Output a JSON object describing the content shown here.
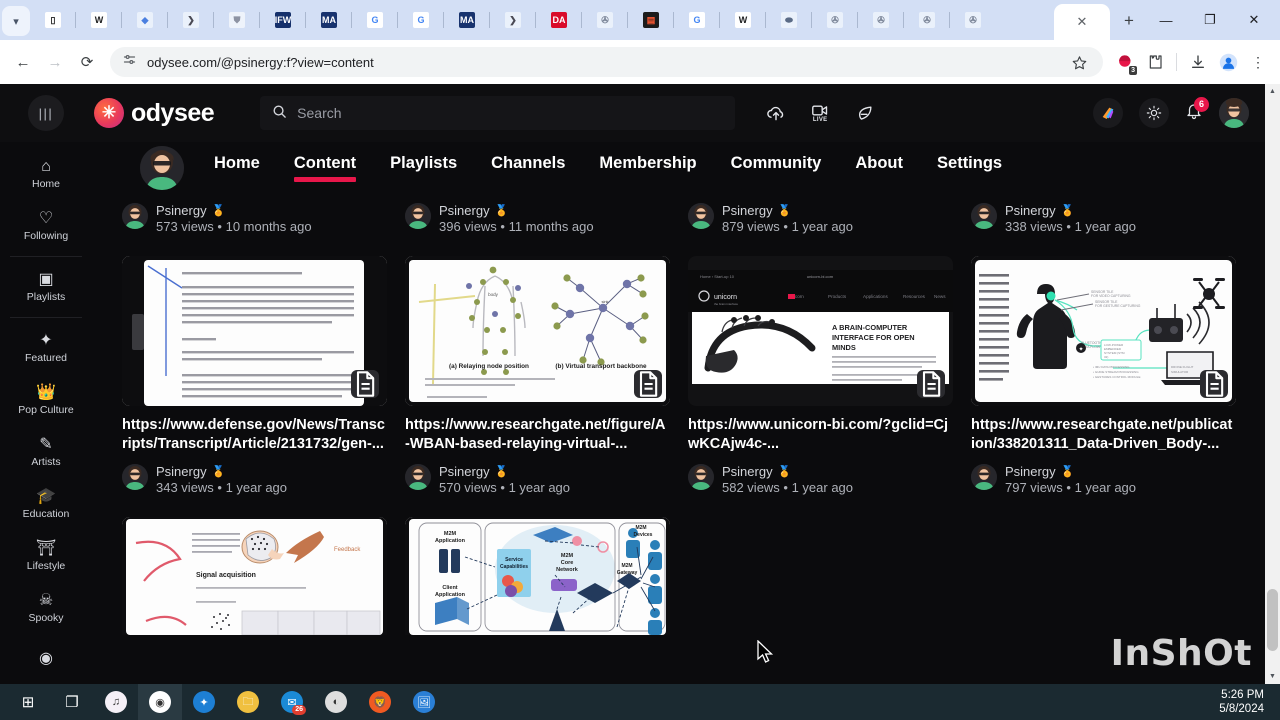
{
  "browser": {
    "tab_scroll_icon": "chevron-down-icon",
    "tabs": [
      {
        "icon": "reading-list-icon",
        "label": "▯",
        "bg": "#ffffff",
        "fg": "#1a1a1a"
      },
      {
        "icon": "wikipedia-icon",
        "label": "W",
        "bg": "#ffffff",
        "fg": "#202122"
      },
      {
        "icon": "diamond-icon",
        "label": "◆",
        "bg": "#eaf1fb",
        "fg": "#4a7fe0"
      },
      {
        "icon": "brave-icon",
        "label": "❯",
        "bg": "#eaf1fb",
        "fg": "#4a4a55"
      },
      {
        "icon": "shield-icon",
        "label": "⛊",
        "bg": "#eef3fb",
        "fg": "#8d93a3"
      },
      {
        "icon": "ifw-icon",
        "label": "IFW",
        "bg": "#15306b",
        "fg": "#ffffff"
      },
      {
        "icon": "ma-icon",
        "label": "MA",
        "bg": "#18336e",
        "fg": "#ffffff"
      },
      {
        "icon": "google-icon",
        "label": "G",
        "bg": "#ffffff",
        "fg": "#4285f4"
      },
      {
        "icon": "google-icon",
        "label": "G",
        "bg": "#ffffff",
        "fg": "#4285f4"
      },
      {
        "icon": "ma-icon",
        "label": "MA",
        "bg": "#18336e",
        "fg": "#ffffff"
      },
      {
        "icon": "brave-icon",
        "label": "❯",
        "bg": "#eaf1fb",
        "fg": "#4a4a55"
      },
      {
        "icon": "daic-icon",
        "label": "DA",
        "bg": "#d90b2a",
        "fg": "#ffffff"
      },
      {
        "icon": "globe-icon",
        "label": "✇",
        "bg": "#eaf1fb",
        "fg": "#7a8497"
      },
      {
        "icon": "news-icon",
        "label": "▤",
        "bg": "#1c1c1c",
        "fg": "#ff5a33"
      },
      {
        "icon": "google-icon",
        "label": "G",
        "bg": "#ffffff",
        "fg": "#4285f4"
      },
      {
        "icon": "wikipedia-icon",
        "label": "W",
        "bg": "#ffffff",
        "fg": "#202122"
      },
      {
        "icon": "link-icon",
        "label": "⬬",
        "bg": "#eaf1fb",
        "fg": "#5a6b86"
      },
      {
        "icon": "globe-icon",
        "label": "✇",
        "bg": "#eaf1fb",
        "fg": "#7a8497"
      },
      {
        "icon": "globe-icon",
        "label": "✇",
        "bg": "#eaf1fb",
        "fg": "#7a8497"
      },
      {
        "icon": "globe-icon",
        "label": "✇",
        "bg": "#eaf1fb",
        "fg": "#7a8497"
      },
      {
        "icon": "globe-icon",
        "label": "✇",
        "bg": "#eaf1fb",
        "fg": "#7a8497"
      }
    ],
    "active_tab_close": "✕",
    "new_tab_label": "+",
    "window_minimize": "—",
    "window_maximize": "❐",
    "window_close": "✕",
    "back_label": "←",
    "forward_label": "→",
    "reload_label": "⟳",
    "site_info_icon": "tune-icon",
    "url": "odysee.com/@psinergy:f?view=content",
    "bookmark_icon": "star-icon",
    "extension_badge_count": "3",
    "extensions_icon": "puzzle-icon",
    "downloads_icon": "download-icon",
    "profile_icon": "account-icon",
    "menu_icon": "kebab-menu-icon"
  },
  "odysee": {
    "brand_name": "odysee",
    "menu_icon": "hamburger-icon",
    "search": {
      "placeholder": "Search",
      "value": "",
      "icon": "magnifier-icon"
    },
    "header_actions": [
      {
        "name": "upload-icon",
        "glyph": "☁"
      },
      {
        "name": "go-live-icon",
        "glyph": "▣",
        "sub": "LIVE"
      },
      {
        "name": "post-icon",
        "glyph": "✎"
      }
    ],
    "header_right": [
      {
        "name": "rewards-icon",
        "glyph": "◥"
      },
      {
        "name": "theme-toggle-icon",
        "glyph": "☀"
      }
    ],
    "notification_count": "6",
    "notification_icon": "bell-icon",
    "avatar_name": "user-avatar"
  },
  "sidebar": {
    "items": [
      {
        "label": "Home",
        "icon": "home-icon",
        "glyph": "⌂"
      },
      {
        "label": "Following",
        "icon": "heart-icon",
        "glyph": "♡"
      },
      {
        "divider": true
      },
      {
        "label": "Playlists",
        "icon": "playlists-icon",
        "glyph": "▣"
      },
      {
        "divider": true
      },
      {
        "label": "Featured",
        "icon": "sparkle-icon",
        "glyph": "✦"
      },
      {
        "label": "Pop Culture",
        "icon": "pop-culture-icon",
        "glyph": "👑"
      },
      {
        "label": "Artists",
        "icon": "brush-icon",
        "glyph": "✎"
      },
      {
        "label": "Education",
        "icon": "graduation-cap-icon",
        "glyph": "🎓"
      },
      {
        "label": "Lifestyle",
        "icon": "lifestyle-icon",
        "glyph": "⛩"
      },
      {
        "label": "Spooky",
        "icon": "skull-icon",
        "glyph": "☠"
      },
      {
        "label": "",
        "icon": "gaming-icon",
        "glyph": "◉"
      }
    ]
  },
  "channel_nav": {
    "avatar_name": "channel-avatar",
    "tabs": [
      {
        "label": "Home",
        "active": false
      },
      {
        "label": "Content",
        "active": true
      },
      {
        "label": "Playlists",
        "active": false
      },
      {
        "label": "Channels",
        "active": false
      },
      {
        "label": "Membership",
        "active": false
      },
      {
        "label": "Community",
        "active": false
      },
      {
        "label": "About",
        "active": false
      },
      {
        "label": "Settings",
        "active": false
      }
    ],
    "accent_color": "#e8174a"
  },
  "top_row_partial": [
    {
      "channel": "Psinergy",
      "meta": "573 views • 10 months ago"
    },
    {
      "channel": "Psinergy",
      "meta": "396 views • 11 months ago"
    },
    {
      "channel": "Psinergy",
      "meta": "879 views • 1 year ago"
    },
    {
      "channel": "Psinergy",
      "meta": "338 views • 1 year ago"
    }
  ],
  "cards": [
    {
      "title": "https://www.defense.gov/News/Transcripts/Transcript/Article/2131732/gen-...",
      "channel": "Psinergy",
      "meta": "343 views • 1 year ago",
      "thumb": "defense-transcript-document",
      "badge_icon": "document-icon"
    },
    {
      "title": "https://www.researchgate.net/figure/A-WBAN-based-relaying-virtual-...",
      "channel": "Psinergy",
      "meta": "570 views • 1 year ago",
      "thumb": "wban-relaying-node-diagram",
      "badge_icon": "document-icon",
      "thumb_caption_a": "(a) Relaying node position",
      "thumb_caption_b": "(b) Virtual transport backbone"
    },
    {
      "title": "https://www.unicorn-bi.com/?gclid=CjwKCAjw4c-...",
      "channel": "Psinergy",
      "meta": "582 views • 1 year ago",
      "thumb": "unicorn-bci-webpage",
      "badge_icon": "document-icon",
      "thumb_heading": "A BRAIN-COMPUTER INTERFACE FOR OPEN MINDS",
      "thumb_brand": "unicorn"
    },
    {
      "title": "https://www.researchgate.net/publication/338201311_Data-Driven_Body-...",
      "channel": "Psinergy",
      "meta": "797 views • 1 year ago",
      "thumb": "body-machine-drone-control-diagram",
      "badge_icon": "document-icon"
    }
  ],
  "bottom_row": [
    {
      "thumb": "eeg-signal-acquisition-diagram",
      "caption": "Signal acquisition",
      "label": "Feedback"
    },
    {
      "thumb": "m2m-network-architecture-diagram",
      "labels": [
        "M2M Application",
        "Client Application",
        "Service Capabilities",
        "M2M Core Network",
        "M2M Gateway",
        "M2M Devices"
      ]
    }
  ],
  "watermark": "InShOt",
  "taskbar": {
    "items": [
      {
        "name": "start-button",
        "glyph": "⊞"
      },
      {
        "name": "task-view-button",
        "glyph": "❐"
      },
      {
        "name": "itunes-taskbar-icon",
        "glyph": "♫"
      },
      {
        "name": "chrome-taskbar-icon",
        "glyph": "◉"
      },
      {
        "name": "bluetooth-taskbar-icon",
        "glyph": "✦"
      },
      {
        "name": "file-explorer-taskbar-icon",
        "glyph": "🗀"
      },
      {
        "name": "mail-taskbar-icon",
        "glyph": "✉",
        "badge": "26"
      },
      {
        "name": "media-player-taskbar-icon",
        "glyph": "◐"
      },
      {
        "name": "brave-taskbar-icon",
        "glyph": "🦁"
      },
      {
        "name": "photos-taskbar-icon",
        "glyph": "🖼"
      }
    ],
    "time": "5:26 PM",
    "date": "5/8/2024"
  }
}
